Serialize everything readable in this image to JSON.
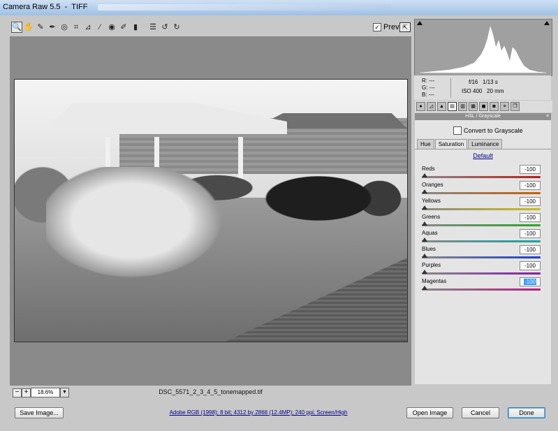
{
  "window": {
    "title": "Camera Raw 5.5  -  TIFF"
  },
  "toolbar": {
    "tools": [
      {
        "name": "zoom-tool-icon",
        "glyph": "🔍"
      },
      {
        "name": "hand-tool-icon",
        "glyph": "✋"
      },
      {
        "name": "white-balance-tool-icon",
        "glyph": "✎"
      },
      {
        "name": "color-sampler-tool-icon",
        "glyph": "✒"
      },
      {
        "name": "targeted-adjustment-tool-icon",
        "glyph": "◎"
      },
      {
        "name": "crop-tool-icon",
        "glyph": "⌗"
      },
      {
        "name": "straighten-tool-icon",
        "glyph": "⊿"
      },
      {
        "name": "spot-removal-tool-icon",
        "glyph": "⁄"
      },
      {
        "name": "red-eye-tool-icon",
        "glyph": "◉"
      },
      {
        "name": "adjustment-brush-icon",
        "glyph": "✐"
      },
      {
        "name": "graduated-filter-icon",
        "glyph": "▮"
      },
      {
        "name": "preferences-icon",
        "glyph": "☰"
      },
      {
        "name": "rotate-ccw-icon",
        "glyph": "↺"
      },
      {
        "name": "rotate-cw-icon",
        "glyph": "↻"
      }
    ],
    "preview_label": "Preview",
    "preview_checked": true
  },
  "status": {
    "zoom": "18.6%",
    "filename": "DSC_5571_2_3_4_5_tonemapped.tif"
  },
  "readout": {
    "r": "R:   ---",
    "g": "G:   ---",
    "b": "B:   ---",
    "aperture": "f/16",
    "shutter": "1/13 s",
    "iso": "ISO 400",
    "focal": "20 mm"
  },
  "panel": {
    "title": "HSL / Grayscale",
    "convert_label": "Convert to Grayscale",
    "tabs": [
      "Hue",
      "Saturation",
      "Luminance"
    ],
    "active_tab": "Saturation",
    "default_label": "Default",
    "sliders": [
      {
        "label": "Reds",
        "value": "-100",
        "color": "linear-gradient(90deg,#888,#b02020)"
      },
      {
        "label": "Oranges",
        "value": "-100",
        "color": "linear-gradient(90deg,#888,#c06010)"
      },
      {
        "label": "Yellows",
        "value": "-100",
        "color": "linear-gradient(90deg,#888,#c8c020)"
      },
      {
        "label": "Greens",
        "value": "-100",
        "color": "linear-gradient(90deg,#888,#30a030)"
      },
      {
        "label": "Aquas",
        "value": "-100",
        "color": "linear-gradient(90deg,#888,#20a0a0)"
      },
      {
        "label": "Blues",
        "value": "-100",
        "color": "linear-gradient(90deg,#888,#2040c0)"
      },
      {
        "label": "Purples",
        "value": "-100",
        "color": "linear-gradient(90deg,#888,#8020a0)"
      },
      {
        "label": "Magentas",
        "value": "-100",
        "color": "linear-gradient(90deg,#888,#b02080)"
      }
    ]
  },
  "footer": {
    "save_label": "Save Image...",
    "info_link": "Adobe RGB (1998); 8 bit; 4312 by 2868 (12.4MP); 240 ppi; Screen/High",
    "open_label": "Open Image",
    "cancel_label": "Cancel",
    "done_label": "Done"
  }
}
